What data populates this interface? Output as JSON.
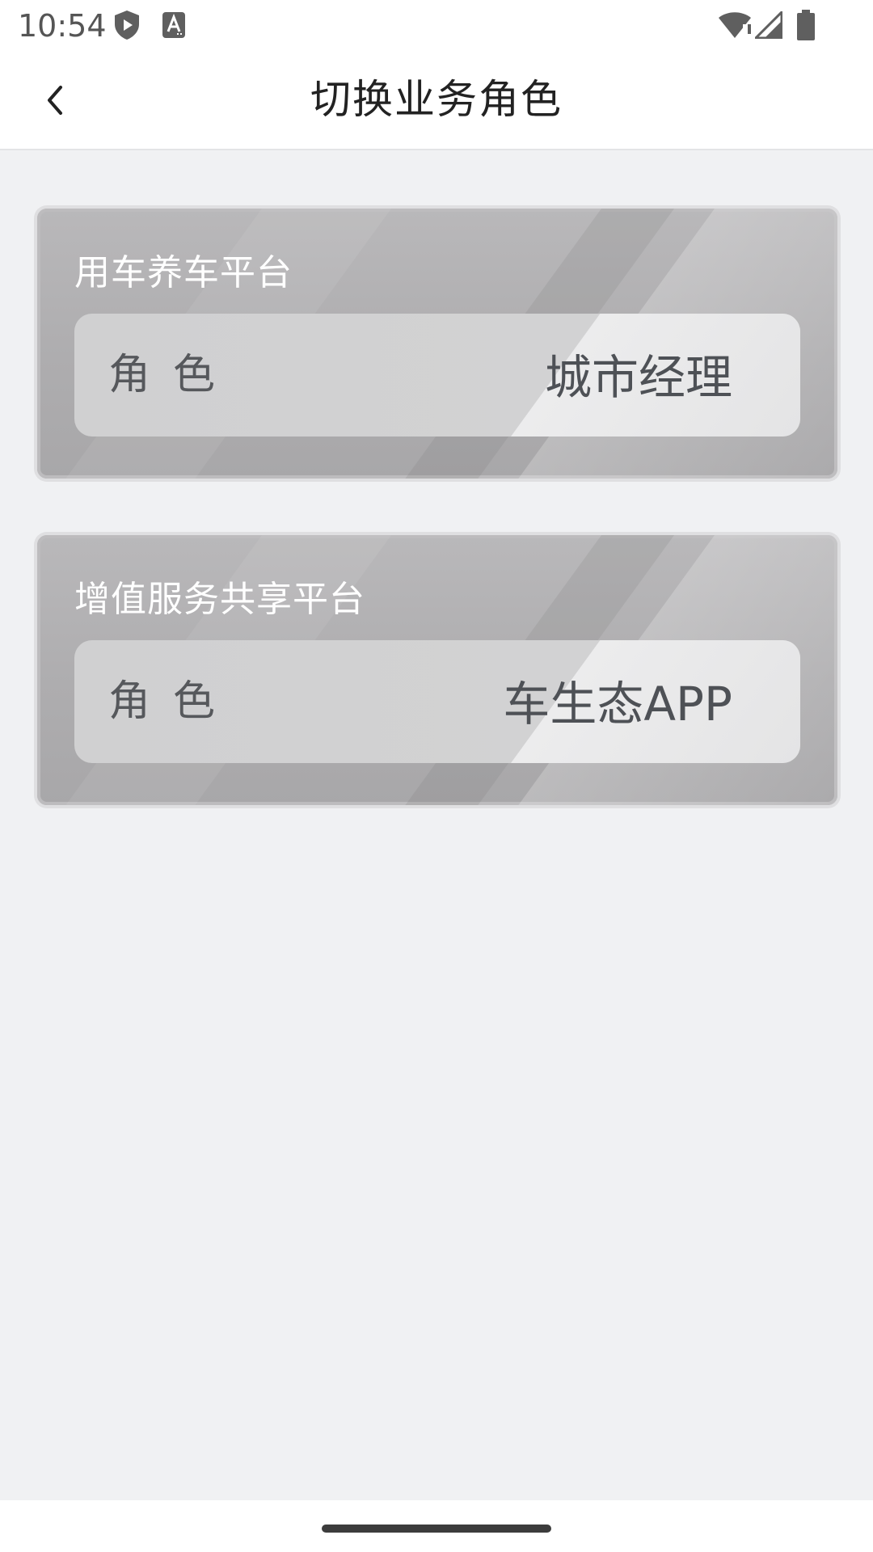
{
  "status_bar": {
    "time": "10:54",
    "icons": [
      "shield-play-icon",
      "font-a-icon",
      "wifi-icon",
      "signal-icon",
      "battery-icon"
    ]
  },
  "header": {
    "title": "切换业务角色",
    "back_icon": "chevron-left-icon"
  },
  "platforms": [
    {
      "title": "用车养车平台",
      "role_label": "角色",
      "role_value": "城市经理"
    },
    {
      "title": "增值服务共享平台",
      "role_label": "角色",
      "role_value": "车生态APP"
    }
  ],
  "colors": {
    "background": "#f0f1f3",
    "card": "#b3b2b4",
    "card_title": "#ffffff",
    "role_text": "#56585c"
  }
}
